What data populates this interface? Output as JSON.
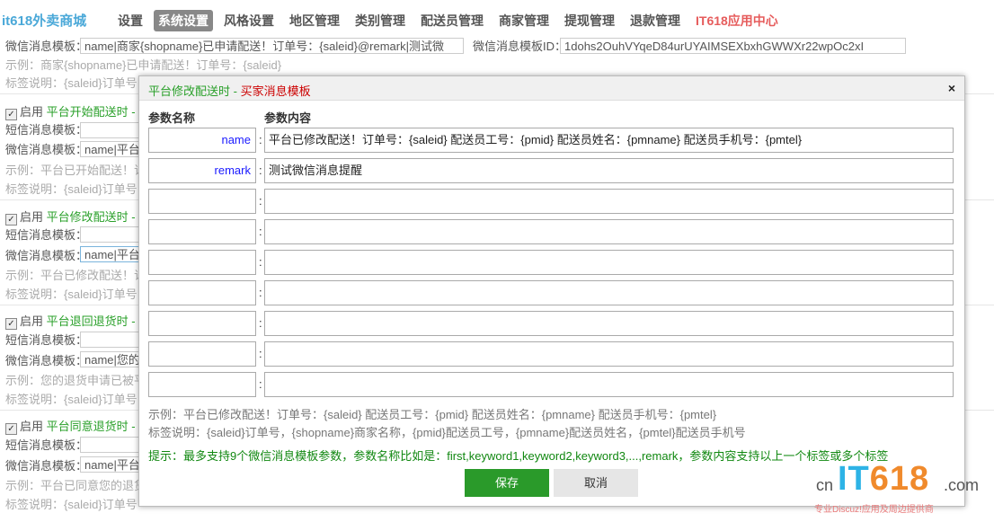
{
  "nav": {
    "brand": "it618外卖商城",
    "items": [
      "设置",
      "系统设置",
      "风格设置",
      "地区管理",
      "类别管理",
      "配送员管理",
      "商家管理",
      "提现管理",
      "退款管理",
      "IT618应用中心"
    ],
    "active_index": 1
  },
  "background": {
    "row0_wx_label": "微信消息模板：",
    "row0_wx_value": "name|商家{shopname}已申请配送！订单号：{saleid}@remark|测试微",
    "row0_wx_label2": "微信消息模板ID：",
    "row0_wx_id": "1dohs2OuhVYqeD84urUYAIMSEXbxhGWWXr22wpOc2xI",
    "row0_example": "示例：商家{shopname}已申请配送！订单号：{saleid}",
    "row0_tags": "标签说明：{saleid}订单号",
    "enable": "启用",
    "sms_label": "短信消息模板：",
    "wx_label": "微信消息模板：",
    "tags_label": "标签说明：{saleid}订单号",
    "sections": [
      {
        "title": "平台开始配送时 - 买",
        "wx_value": "name|平台",
        "example": "示例：平台已开始配送！订单"
      },
      {
        "title": "平台修改配送时 - 买",
        "wx_value": "name|平台",
        "example": "示例：平台已修改配送！订单"
      },
      {
        "title": "平台退回退货时 - 买",
        "wx_value": "name|您的",
        "example": "示例：您的退货申请已被平台"
      },
      {
        "title": "平台同意退货时 - 买",
        "wx_value": "name|平台",
        "example": "示例：平台已同意您的退货"
      }
    ]
  },
  "modal": {
    "title_main": "平台修改配送时",
    "title_sep": " - ",
    "title_sub": "买家消息模板",
    "col_name": "参数名称",
    "col_content": "参数内容",
    "params": [
      {
        "name": "name",
        "value": "平台已修改配送！订单号：{saleid} 配送员工号：{pmid} 配送员姓名：{pmname} 配送员手机号：{pmtel}"
      },
      {
        "name": "remark",
        "value": "测试微信消息提醒"
      },
      {
        "name": "",
        "value": ""
      },
      {
        "name": "",
        "value": ""
      },
      {
        "name": "",
        "value": ""
      },
      {
        "name": "",
        "value": ""
      },
      {
        "name": "",
        "value": ""
      },
      {
        "name": "",
        "value": ""
      },
      {
        "name": "",
        "value": ""
      }
    ],
    "example": "示例：平台已修改配送！订单号：{saleid} 配送员工号：{pmid} 配送员姓名：{pmname} 配送员手机号：{pmtel}",
    "tags": "标签说明：{saleid}订单号，{shopname}商家名称，{pmid}配送员工号，{pmname}配送员姓名，{pmtel}配送员手机号",
    "tip": "提示：最多支持9个微信消息模板参数，参数名称比如是：first,keyword1,keyword2,keyword3,...,remark，参数内容支持以上一个标签或多个标签",
    "save_label": "保存",
    "cancel_label": "取消",
    "close_label": "×"
  },
  "watermark": {
    "cn": "cn",
    "it": "IT",
    "num": "618",
    "com": ".com",
    "sub": "专业Discuz!应用及周边提供商"
  }
}
